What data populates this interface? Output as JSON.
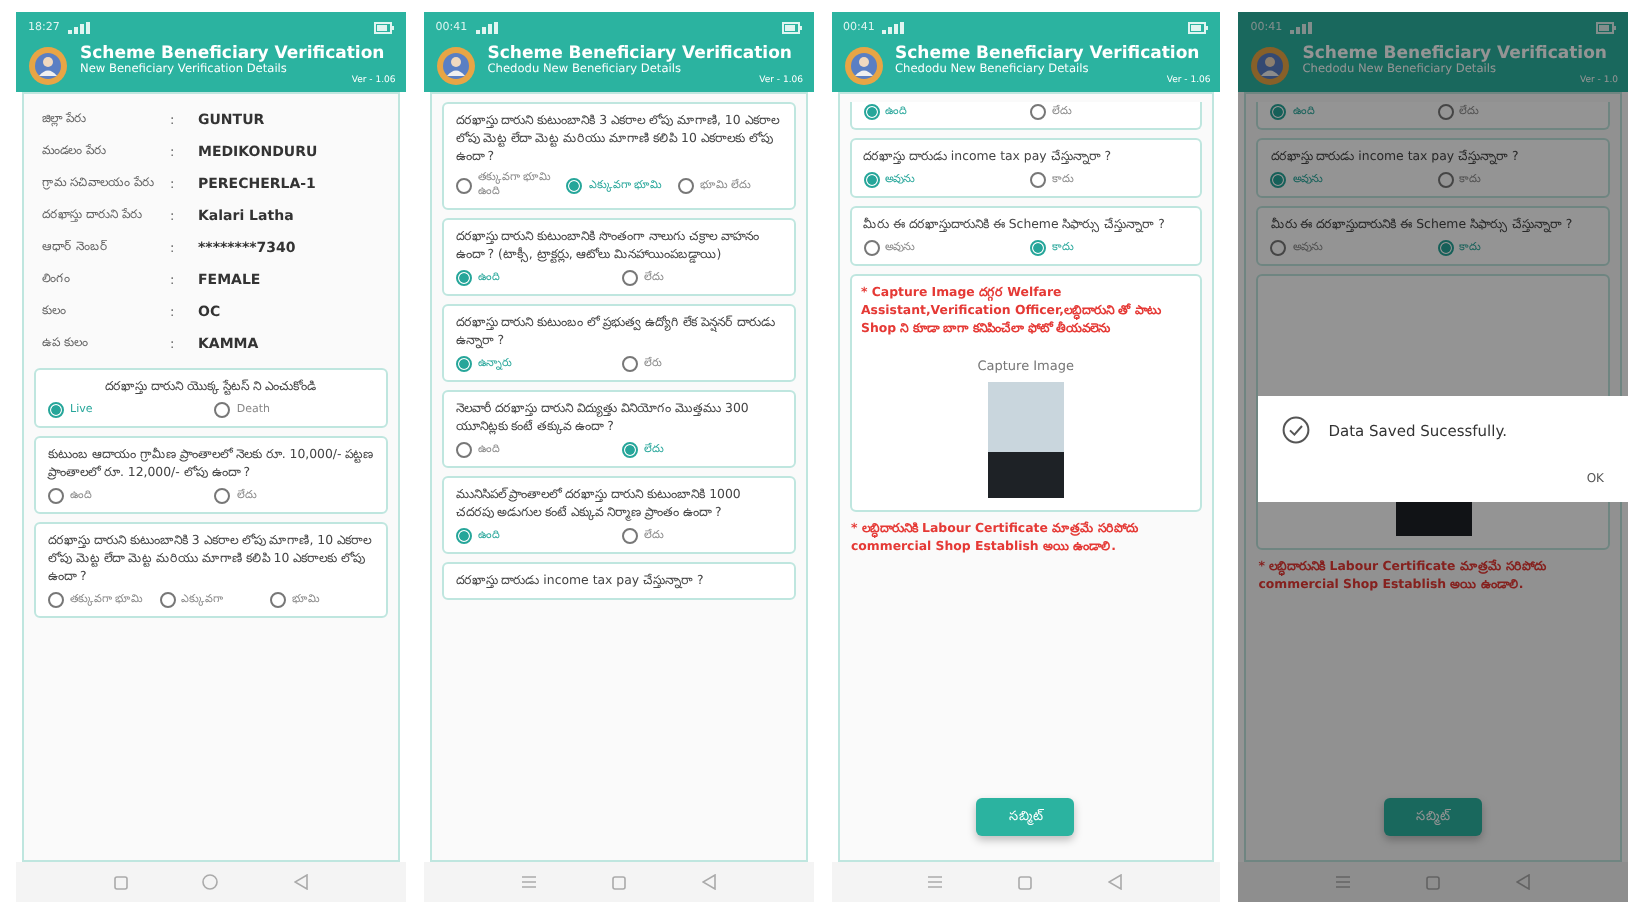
{
  "phones": [
    {
      "status_time": "18:27",
      "title": "Scheme Beneficiary Verification",
      "subtitle": "New Beneficiary Verification Details",
      "version": "Ver - 1.06",
      "nav": [
        {
          "kind": "square"
        },
        {
          "kind": "circle"
        },
        {
          "kind": "back"
        }
      ],
      "items": [
        {
          "kind": "details",
          "rows": [
            {
              "label": "జిల్లా పేరు",
              "separator": ":",
              "value": "GUNTUR"
            },
            {
              "label": "మండలం పేరు",
              "separator": ":",
              "value": "MEDIKONDURU"
            },
            {
              "label": "గ్రామ సచివాలయం పేరు",
              "separator": ":",
              "value": "PERECHERLA-1"
            },
            {
              "label": "దరఖాస్తు దారుని పేరు",
              "separator": ":",
              "value": "Kalari Latha"
            },
            {
              "label": "ఆధార్ నెంబర్",
              "separator": ":",
              "value": "********7340"
            },
            {
              "label": "లింగం",
              "separator": ":",
              "value": "FEMALE"
            },
            {
              "label": "కులం",
              "separator": ":",
              "value": "OC"
            },
            {
              "label": "ఉప కులం",
              "separator": ":",
              "value": "KAMMA"
            }
          ]
        },
        {
          "kind": "question",
          "centered": true,
          "text": "దరఖాస్తు దారుని యొక్క స్టేటస్ ని ఎంచుకోండి",
          "options": [
            {
              "label": "Live",
              "selected": true
            },
            {
              "label": "Death",
              "selected": false
            }
          ]
        },
        {
          "kind": "question",
          "text": "కుటుంబ ఆదాయం గ్రామీణ ప్రాంతాలలో నెలకు రూ. 10,000/- పట్టణ ప్రాంతాలలో రూ. 12,000/- లోపు ఉందా ?",
          "options": [
            {
              "label": "ఉంది",
              "selected": false
            },
            {
              "label": "లేదు",
              "selected": false
            }
          ]
        },
        {
          "kind": "question",
          "text": "దరఖాస్తు దారుని కుటుంబానికి 3 ఎకరాల లోపు మాగాణి, 10 ఎకరాల లోపు మెట్ట లేదా మెట్ట మరియు మాగాణి కలిపి 10 ఎకరాలకు లోపు ఉందా ?",
          "options": [
            {
              "label": "తక్కువగా భూమి",
              "selected": false
            },
            {
              "label": "ఎక్కువగా",
              "selected": false
            },
            {
              "label": "భూమి",
              "selected": false
            }
          ]
        }
      ]
    },
    {
      "status_time": "00:41",
      "title": "Scheme Beneficiary Verification",
      "subtitle": "Chedodu New Beneficiary Details",
      "version": "Ver - 1.06",
      "nav": [
        {
          "kind": "menu"
        },
        {
          "kind": "square"
        },
        {
          "kind": "back"
        }
      ],
      "items": [
        {
          "kind": "question",
          "text": "దరఖాస్తు దారుని కుటుంబానికి 3 ఎకరాల లోపు మాగాణి, 10 ఎకరాల లోపు మెట్ట లేదా మెట్ట మరియు మాగాణి కలిపి 10 ఎకరాలకు లోపు ఉందా ?",
          "options": [
            {
              "label": "తక్కువగా భూమి ఉంది",
              "selected": false
            },
            {
              "label": "ఎక్కువగా భూమి",
              "selected": true
            },
            {
              "label": "భూమి లేదు",
              "selected": false
            }
          ]
        },
        {
          "kind": "question",
          "text": "దరఖాస్తు దారుని కుటుంబానికి సొంతంగా నాలుగు చక్రాల వాహనం ఉందా ? (టాక్సీ, ట్రాక్టర్లు, ఆటోలు మినహాయింపబడ్డాయి)",
          "options": [
            {
              "label": "ఉంది",
              "selected": true
            },
            {
              "label": "లేదు",
              "selected": false
            }
          ]
        },
        {
          "kind": "question",
          "text": "దరఖాస్తు దారుని కుటుంబం లో ప్రభుత్వ ఉద్యోగి లేక పెన్షనర్ దారుడు ఉన్నారా ?",
          "options": [
            {
              "label": "ఉన్నారు",
              "selected": true
            },
            {
              "label": "లేరు",
              "selected": false
            }
          ]
        },
        {
          "kind": "question",
          "text": "నెలవారీ దరఖాస్తు దారుని విద్యుత్తు వినియోగం మొత్తము 300 యూనిట్లకు కంటే తక్కువ ఉందా ?",
          "options": [
            {
              "label": "ఉంది",
              "selected": false
            },
            {
              "label": "లేదు",
              "selected": true
            }
          ]
        },
        {
          "kind": "question",
          "text": "మునిసిపల్ ప్రాంతాలలో దరఖాస్తు దారుని కుటుంబానికి 1000 చదరపు అడుగుల కంటే ఎక్కువ నిర్మాణ ప్రాంతం ఉందా ?",
          "options": [
            {
              "label": "ఉంది",
              "selected": true
            },
            {
              "label": "లేదు",
              "selected": false
            }
          ]
        },
        {
          "kind": "question",
          "text": "దరఖాస్తు దారుడు income tax pay చేస్తున్నారా ?"
        }
      ]
    },
    {
      "status_time": "00:41",
      "title": "Scheme Beneficiary Verification",
      "subtitle": "Chedodu New Beneficiary Details",
      "version": "Ver - 1.06",
      "nav": [
        {
          "kind": "menu"
        },
        {
          "kind": "square"
        },
        {
          "kind": "back"
        }
      ],
      "items": [
        {
          "kind": "options",
          "options": [
            {
              "label": "ఉంది",
              "selected": true
            },
            {
              "label": "లేదు",
              "selected": false
            }
          ]
        },
        {
          "kind": "question",
          "text": "దరఖాస్తు దారుడు income tax pay చేస్తున్నారా ?",
          "options": [
            {
              "label": "అవును",
              "selected": true
            },
            {
              "label": "కాదు",
              "selected": false
            }
          ]
        },
        {
          "kind": "question",
          "text": "మీరు ఈ దరఖాస్తుదారునికి ఈ Scheme సిఫార్సు చేస్తున్నారా ?",
          "options": [
            {
              "label": "అవును",
              "selected": false
            },
            {
              "label": "కాదు",
              "selected": true
            }
          ]
        },
        {
          "kind": "capture",
          "note": "* Capture Image దగ్గర Welfare Assistant,Verification Officer,లబ్ధిదారుని తో పాటు Shop ని కూడా బాగా కనిపించేలా ఫోటో తీయవలెను",
          "label": "Capture Image"
        },
        {
          "kind": "note",
          "text": "* లబ్ధిదారునికి Labour Certificate మాత్రమే సరిపోదు commercial Shop Establish అయి ఉండాలి."
        },
        {
          "kind": "submit",
          "label": "సబ్మిట్"
        }
      ]
    },
    {
      "status_time": "00:41",
      "title": "Scheme Beneficiary Verification",
      "subtitle": "Chedodu New Beneficiary Details",
      "version": "Ver - 1.0",
      "nav": [
        {
          "kind": "menu"
        },
        {
          "kind": "square"
        },
        {
          "kind": "back"
        }
      ],
      "items": [
        {
          "kind": "options",
          "options": [
            {
              "label": "ఉంది",
              "selected": true
            },
            {
              "label": "లేదు",
              "selected": false
            }
          ]
        },
        {
          "kind": "question",
          "text": "దరఖాస్తు దారుడు income tax pay చేస్తున్నారా ?",
          "options": [
            {
              "label": "అవును",
              "selected": true
            },
            {
              "label": "కాదు",
              "selected": false
            }
          ]
        },
        {
          "kind": "question",
          "text": "మీరు ఈ దరఖాస్తుదారునికి ఈ Scheme సిఫార్సు చేస్తున్నారా ?",
          "options": [
            {
              "label": "అవును",
              "selected": false
            },
            {
              "label": "కాదు",
              "selected": true
            }
          ]
        },
        {
          "kind": "capture"
        },
        {
          "kind": "note",
          "text": "* లబ్ధిదారునికి Labour Certificate మాత్రమే సరిపోదు commercial Shop Establish అయి ఉండాలి."
        },
        {
          "kind": "submit",
          "label": "సబ్మిట్"
        }
      ],
      "dialog": {
        "message": "Data Saved Sucessfully.",
        "button": "OK"
      }
    }
  ]
}
